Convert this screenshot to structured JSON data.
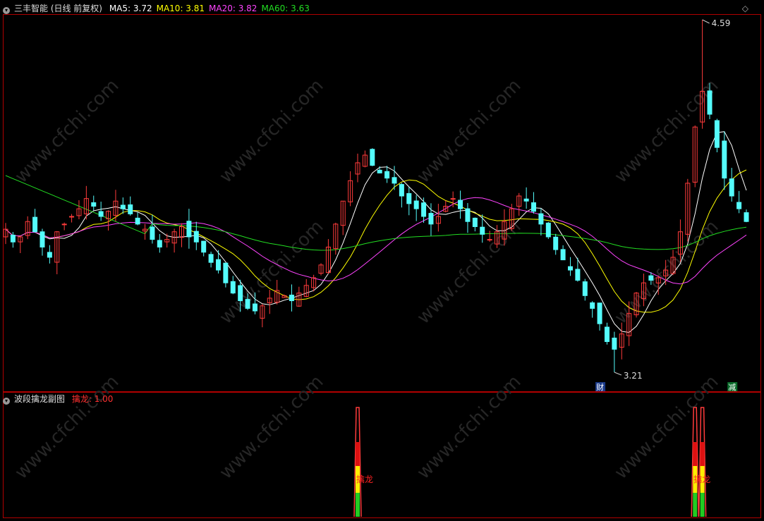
{
  "main_header": {
    "title": "三丰智能 (日线 前复权)",
    "indicators": [
      {
        "label": "MA5: 3.72",
        "color": "#ffffff"
      },
      {
        "label": "MA10: 3.81",
        "color": "#ffff00"
      },
      {
        "label": "MA20: 3.82",
        "color": "#ff44ff"
      },
      {
        "label": "MA60: 3.63",
        "color": "#22dd22"
      }
    ]
  },
  "sub_header": {
    "title": "波段擒龙副图",
    "value_label": "擒龙: 1.00",
    "value_color": "#ff3030"
  },
  "annotations": {
    "high_label": "4.59",
    "low_label": "3.21",
    "badge_cai": "财",
    "badge_jian": "减",
    "signal_label": "擒龙"
  },
  "watermark": "www.cfchi.com",
  "colors": {
    "up": "#ff3b3b",
    "down": "#54fcfc",
    "ma5": "#ffffff",
    "ma10": "#ffff00",
    "ma20": "#ff44ff",
    "ma60": "#22dd22",
    "border": "#b00000"
  },
  "chart_data": {
    "type": "candlestick",
    "y_range": [
      3.21,
      4.59
    ],
    "high": 4.59,
    "low": 3.21,
    "ma_last": {
      "MA5": 3.72,
      "MA10": 3.81,
      "MA20": 3.82,
      "MA60": 3.63
    },
    "closes": [
      3.77,
      3.72,
      3.74,
      3.8,
      3.76,
      3.7,
      3.66,
      3.76,
      3.79,
      3.82,
      3.85,
      3.89,
      3.86,
      3.82,
      3.84,
      3.88,
      3.85,
      3.83,
      3.79,
      3.77,
      3.73,
      3.7,
      3.73,
      3.76,
      3.78,
      3.74,
      3.72,
      3.68,
      3.64,
      3.61,
      3.56,
      3.52,
      3.49,
      3.46,
      3.45,
      3.47,
      3.5,
      3.53,
      3.51,
      3.49,
      3.52,
      3.55,
      3.58,
      3.63,
      3.7,
      3.79,
      3.88,
      3.96,
      4.03,
      4.06,
      4.02,
      3.99,
      3.97,
      3.95,
      3.9,
      3.87,
      3.85,
      3.82,
      3.79,
      3.82,
      3.86,
      3.89,
      3.85,
      3.8,
      3.78,
      3.75,
      3.73,
      3.76,
      3.8,
      3.85,
      3.9,
      3.88,
      3.84,
      3.79,
      3.74,
      3.69,
      3.65,
      3.61,
      3.57,
      3.51,
      3.46,
      3.4,
      3.33,
      3.3,
      3.36,
      3.44,
      3.52,
      3.56,
      3.57,
      3.58,
      3.61,
      3.66,
      3.76,
      3.95,
      4.17,
      4.31,
      4.22,
      4.09,
      3.97,
      3.9,
      3.85,
      3.8
    ],
    "signals": [
      {
        "index": 48,
        "value": 1.0
      },
      {
        "index": 94,
        "value": 1.0
      },
      {
        "index": 95,
        "value": 1.0
      }
    ],
    "sub_y_range": [
      0,
      1.0
    ]
  }
}
